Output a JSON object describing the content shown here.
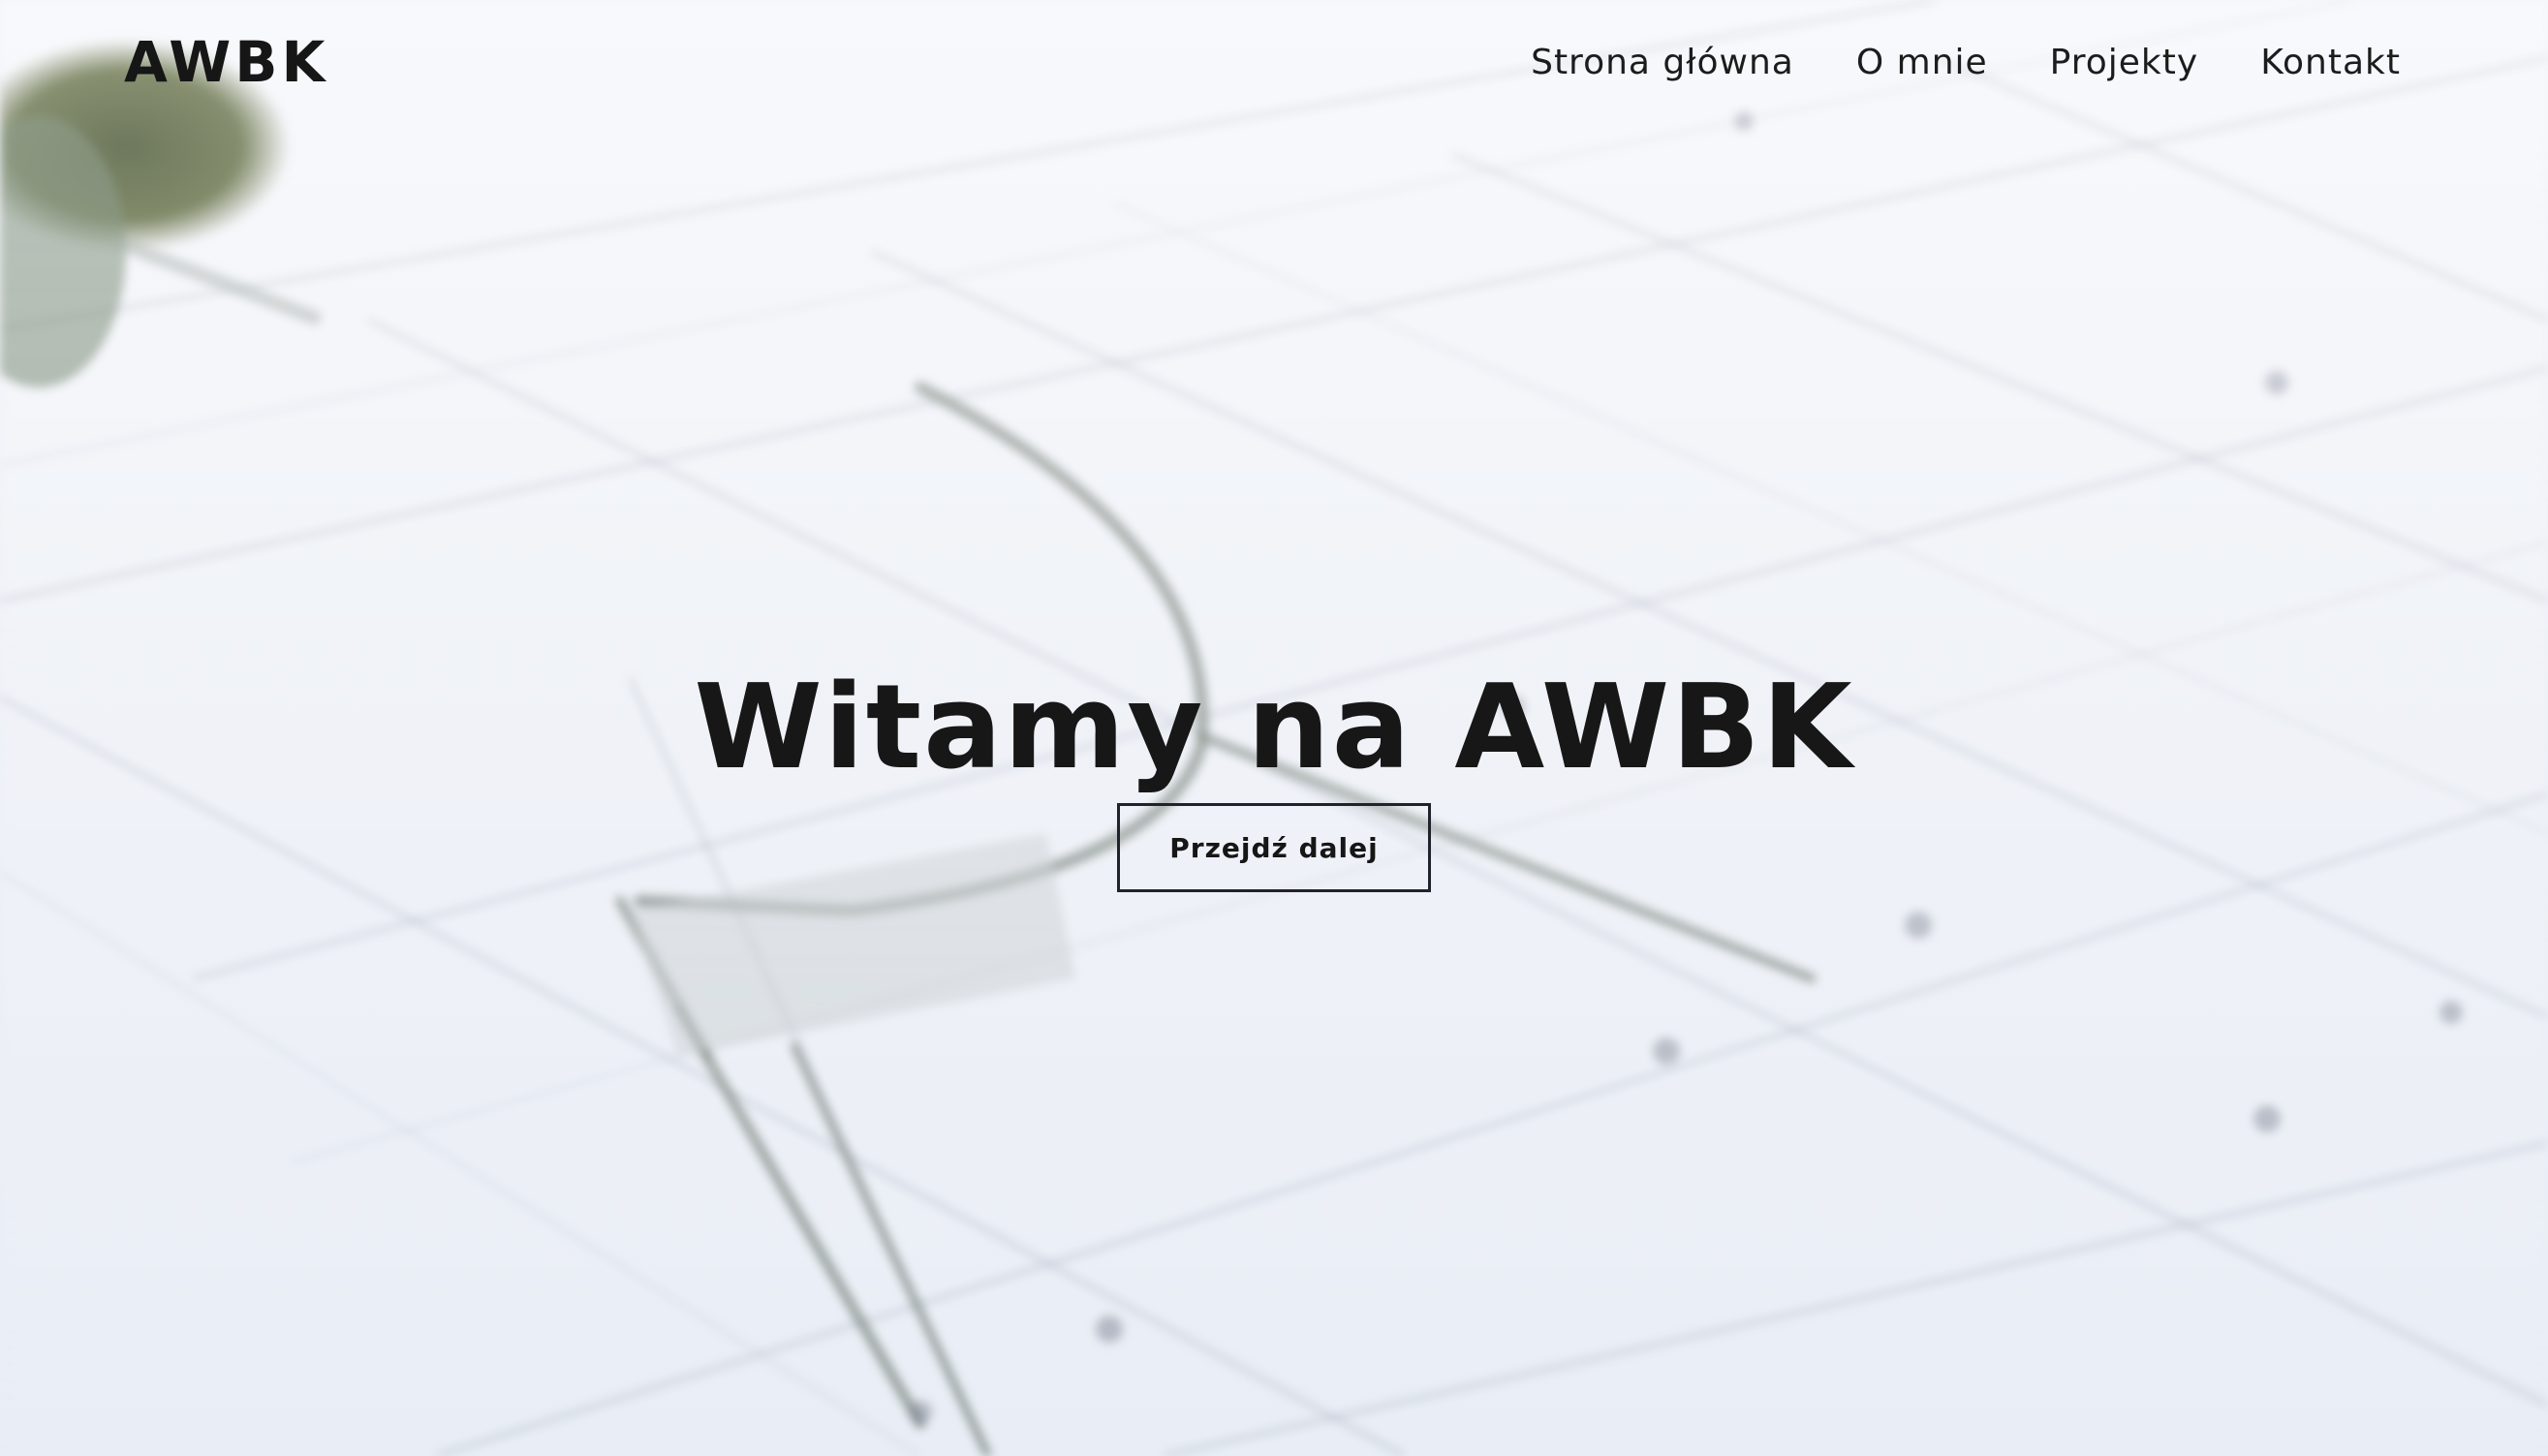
{
  "header": {
    "brand": "AWBK",
    "nav": [
      {
        "label": "Strona główna"
      },
      {
        "label": "O mnie"
      },
      {
        "label": "Projekty"
      },
      {
        "label": "Kontakt"
      }
    ]
  },
  "hero": {
    "title": "Witamy na AWBK",
    "cta_label": "Przejdź dalej",
    "background": "blurred architectural blueprint with drafting compass"
  },
  "colors": {
    "text": "#171717",
    "button_border": "#20222c",
    "background": "#eef2f8"
  }
}
